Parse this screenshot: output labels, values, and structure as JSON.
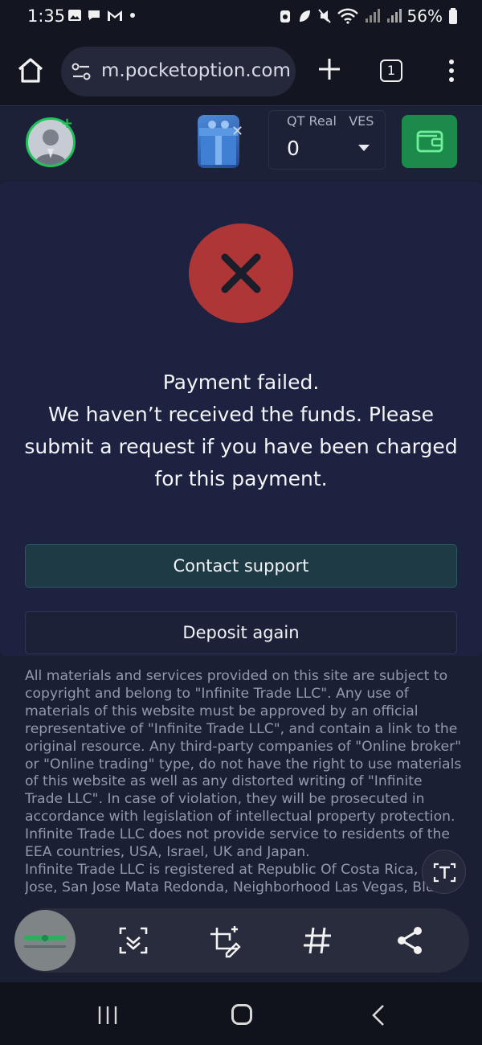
{
  "status_bar": {
    "time": "1:35",
    "battery": "56%"
  },
  "browser": {
    "url": "m.pocketoption.com",
    "tab_count": "1"
  },
  "header": {
    "account_type": "QT Real",
    "currency": "VES",
    "balance": "0"
  },
  "payment": {
    "message": "Payment failed.\nWe haven’t received the funds. Please submit a request if you have been charged for this payment.",
    "contact_label": "Contact support",
    "deposit_label": "Deposit again"
  },
  "legal": {
    "paragraph1": "All materials and services provided on this site are subject to copyright and belong to \"Infinite Trade LLC\". Any use of materials of this website must be approved by an official representative of \"Infinite Trade LLC\", and contain a link to the original resource. Any third-party companies of \"Online broker\" or \"Online trading\" type, do not have the right to use materials of this website as well as any distorted writing of \"Infinite Trade LLC\". In case of violation, they will be prosecuted in accordance with legislation of intellectual property protection.",
    "paragraph2": "Infinite Trade LLC does not provide service to residents of the EEA countries, USA, Israel, UK and Japan.",
    "paragraph3": "Infinite Trade LLC is registered at Republic Of Costa Rica, San Jose, San Jose Mata Redonda, Neighborhood Las Vegas, Blue"
  },
  "icons": {
    "home": "home-icon",
    "site_settings": "tune-icon",
    "new_tab": "plus-icon",
    "tabs": "tabs-counter-icon",
    "menu": "more-vert-icon",
    "wallet": "wallet-icon",
    "failed": "close-x-icon",
    "text_extract": "text-scan-icon",
    "capture_scroll": "scroll-capture-icon",
    "edit": "crop-edit-icon",
    "tag": "hashtag-icon",
    "share": "share-icon"
  },
  "colors": {
    "accent_green": "#21c05a",
    "fail_red": "#ae3636",
    "background": "#1a1f33"
  }
}
